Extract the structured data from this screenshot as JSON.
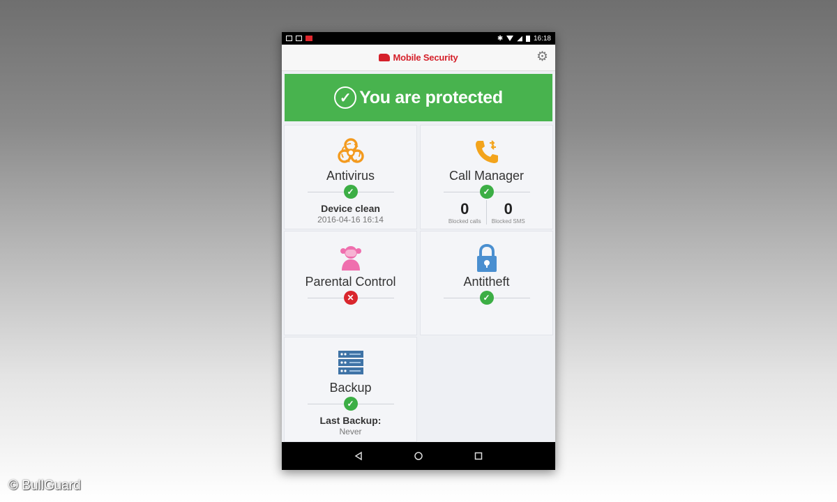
{
  "status_bar": {
    "time": "16:18"
  },
  "app": {
    "title": "Mobile Security",
    "settings_icon": "gear-icon"
  },
  "banner": {
    "text": "You are protected",
    "icon": "check-circle-icon",
    "color": "#48b34e"
  },
  "tiles": {
    "antivirus": {
      "title": "Antivirus",
      "status": "ok",
      "detail": "Device clean",
      "timestamp": "2016-04-16 16:14",
      "icon": "biohazard-icon"
    },
    "call_manager": {
      "title": "Call Manager",
      "status": "ok",
      "blocked_calls": "0",
      "blocked_calls_label": "Blocked calls",
      "blocked_sms": "0",
      "blocked_sms_label": "Blocked SMS",
      "icon": "phone-icon"
    },
    "parental_control": {
      "title": "Parental Control",
      "status": "error",
      "icon": "child-icon"
    },
    "antitheft": {
      "title": "Antitheft",
      "status": "ok",
      "icon": "padlock-icon"
    },
    "backup": {
      "title": "Backup",
      "status": "ok",
      "detail": "Last Backup:",
      "value": "Never",
      "icon": "server-icon"
    }
  },
  "navigation": [
    "back-icon",
    "home-icon",
    "recent-apps-icon"
  ],
  "watermark": "© BullGuard",
  "colors": {
    "brand": "#d5202a",
    "ok": "#3cae45",
    "error": "#d9262d",
    "antivirus": "#f39a1e",
    "parental": "#ef6fae",
    "antitheft": "#4a8fd0",
    "backup": "#3f73a6"
  }
}
